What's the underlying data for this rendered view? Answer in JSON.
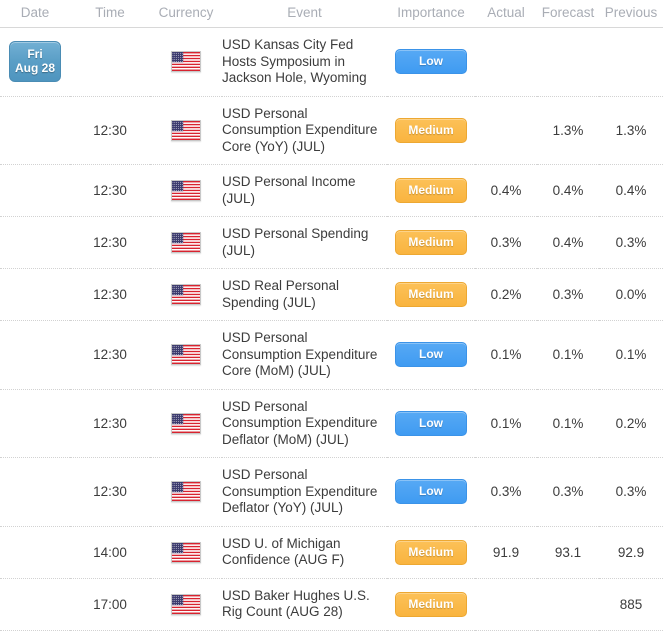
{
  "header": {
    "columns": [
      {
        "key": "date",
        "label": "Date"
      },
      {
        "key": "time",
        "label": "Time"
      },
      {
        "key": "currency",
        "label": "Currency"
      },
      {
        "key": "event",
        "label": "Event"
      },
      {
        "key": "importance",
        "label": "Importance"
      },
      {
        "key": "actual",
        "label": "Actual"
      },
      {
        "key": "forecast",
        "label": "Forecast"
      },
      {
        "key": "previous",
        "label": "Previous"
      }
    ]
  },
  "colors": {
    "badge_low": "#3f9bf2",
    "badge_medium": "#f9b43f",
    "date_badge": "#5a9ec6",
    "value_down": "#e8112d",
    "value_up": "#1a9641",
    "value_neutral": "#3c3c3c",
    "header_text": "#a9adb5"
  },
  "date_badge": {
    "weekday": "Fri",
    "date": "Aug 28"
  },
  "flag_icon": "us-flag-icon",
  "rows": [
    {
      "time": "",
      "currency_icon": "us-flag-icon",
      "event": "USD Kansas City Fed Hosts Symposium in Jackson Hole, Wyoming",
      "importance": "Low",
      "importance_level": "low",
      "actual": "",
      "actual_state": "neutral",
      "forecast": "",
      "previous": "",
      "previous_state": "neutral",
      "has_date_badge": true
    },
    {
      "time": "12:30",
      "currency_icon": "us-flag-icon",
      "event": "USD Personal Consumption Expenditure Core (YoY) (JUL)",
      "importance": "Medium",
      "importance_level": "medium",
      "actual": "",
      "actual_state": "neutral",
      "forecast": "1.3%",
      "previous": "1.3%",
      "previous_state": "neutral",
      "has_date_badge": false
    },
    {
      "time": "12:30",
      "currency_icon": "us-flag-icon",
      "event": "USD Personal Income (JUL)",
      "importance": "Medium",
      "importance_level": "medium",
      "actual": "0.4%",
      "actual_state": "neutral",
      "forecast": "0.4%",
      "previous": "0.4%",
      "previous_state": "neutral",
      "has_date_badge": false
    },
    {
      "time": "12:30",
      "currency_icon": "us-flag-icon",
      "event": "USD Personal Spending (JUL)",
      "importance": "Medium",
      "importance_level": "medium",
      "actual": "0.3%",
      "actual_state": "down",
      "forecast": "0.4%",
      "previous": "0.3%",
      "previous_state": "up",
      "has_date_badge": false
    },
    {
      "time": "12:30",
      "currency_icon": "us-flag-icon",
      "event": "USD Real Personal Spending (JUL)",
      "importance": "Medium",
      "importance_level": "medium",
      "actual": "0.2%",
      "actual_state": "down",
      "forecast": "0.3%",
      "previous": "0.0%",
      "previous_state": "neutral",
      "has_date_badge": false
    },
    {
      "time": "12:30",
      "currency_icon": "us-flag-icon",
      "event": "USD Personal Consumption Expenditure Core (MoM) (JUL)",
      "importance": "Low",
      "importance_level": "low",
      "actual": "0.1%",
      "actual_state": "neutral",
      "forecast": "0.1%",
      "previous": "0.1%",
      "previous_state": "neutral",
      "has_date_badge": false
    },
    {
      "time": "12:30",
      "currency_icon": "us-flag-icon",
      "event": "USD Personal Consumption Expenditure Deflator (MoM) (JUL)",
      "importance": "Low",
      "importance_level": "low",
      "actual": "0.1%",
      "actual_state": "neutral",
      "forecast": "0.1%",
      "previous": "0.2%",
      "previous_state": "neutral",
      "has_date_badge": false
    },
    {
      "time": "12:30",
      "currency_icon": "us-flag-icon",
      "event": "USD Personal Consumption Expenditure Deflator (YoY) (JUL)",
      "importance": "Low",
      "importance_level": "low",
      "actual": "0.3%",
      "actual_state": "neutral",
      "forecast": "0.3%",
      "previous": "0.3%",
      "previous_state": "neutral",
      "has_date_badge": false
    },
    {
      "time": "14:00",
      "currency_icon": "us-flag-icon",
      "event": "USD U. of Michigan Confidence (AUG F)",
      "importance": "Medium",
      "importance_level": "medium",
      "actual": "91.9",
      "actual_state": "down",
      "forecast": "93.1",
      "previous": "92.9",
      "previous_state": "neutral",
      "has_date_badge": false
    },
    {
      "time": "17:00",
      "currency_icon": "us-flag-icon",
      "event": "USD Baker Hughes U.S. Rig Count (AUG 28)",
      "importance": "Medium",
      "importance_level": "medium",
      "actual": "",
      "actual_state": "neutral",
      "forecast": "",
      "previous": "885",
      "previous_state": "neutral",
      "has_date_badge": false
    }
  ]
}
